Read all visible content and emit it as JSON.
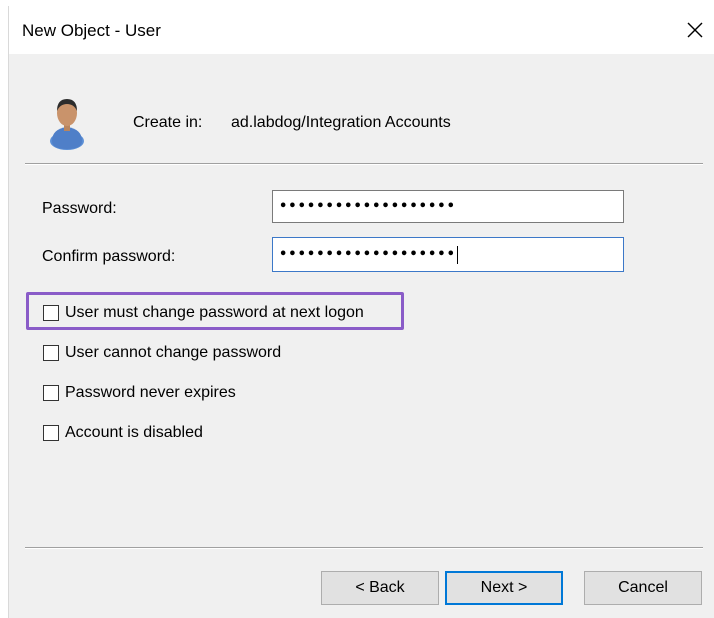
{
  "window": {
    "title": "New Object - User",
    "close_icon": "close-icon"
  },
  "header": {
    "icon": "user-icon",
    "create_in_label": "Create in:",
    "create_in_value": "ad.labdog/Integration Accounts"
  },
  "fields": {
    "password_label": "Password:",
    "password_value": "•••••••••••••••••••",
    "confirm_label": "Confirm password:",
    "confirm_value": "•••••••••••••••••••"
  },
  "options": [
    {
      "label": "User must change password at next logon",
      "checked": false,
      "highlighted": true
    },
    {
      "label": "User cannot change password",
      "checked": false
    },
    {
      "label": "Password never expires",
      "checked": false
    },
    {
      "label": "Account is disabled",
      "checked": false
    }
  ],
  "buttons": {
    "back": "< Back",
    "next": "Next >",
    "cancel": "Cancel"
  },
  "colors": {
    "highlight_border": "#8a5cc8",
    "focus_border": "#0078d7"
  }
}
